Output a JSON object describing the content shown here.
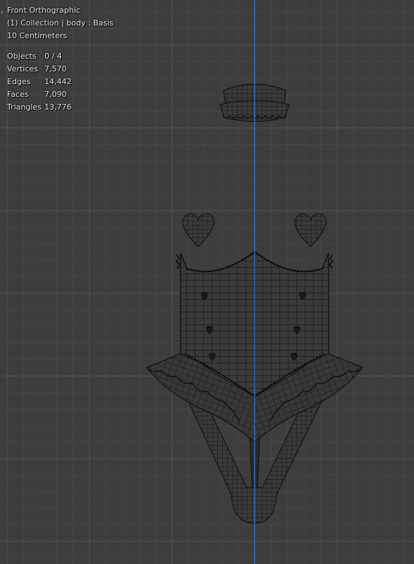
{
  "viewport": {
    "view_name": "Front Orthographic",
    "collection_info": "(1) Collection | body : Basis",
    "scale_info": "10 Centimeters",
    "expand_icon": "chevron-right-icon"
  },
  "stats": [
    {
      "label": "Objects",
      "value": "0 / 4"
    },
    {
      "label": "Vertices",
      "value": "7,570"
    },
    {
      "label": "Edges",
      "value": "14,442"
    },
    {
      "label": "Faces",
      "value": "7,090"
    },
    {
      "label": "Triangles",
      "value": "13,776"
    }
  ],
  "colors": {
    "background": "#3d3d3d",
    "grid_minor": "#474747",
    "grid_major": "#555555",
    "z_axis": "#2e6bcf",
    "wire": "#0b0b0b",
    "mesh_fill": "#3a3a3a"
  }
}
